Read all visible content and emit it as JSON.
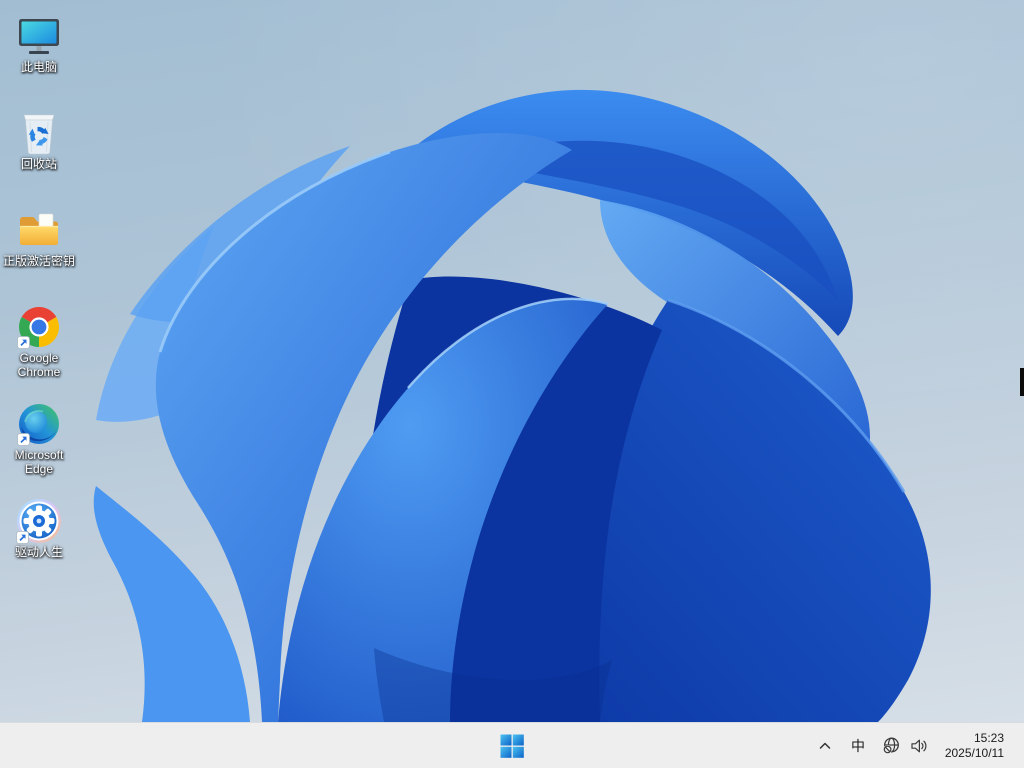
{
  "desktop": {
    "icons": [
      {
        "label": "此电脑",
        "icon": "this-pc-monitor-icon"
      },
      {
        "label": "回收站",
        "icon": "recycle-bin-icon"
      },
      {
        "label": "正版激活密钥",
        "icon": "yellow-folder-icon"
      },
      {
        "label": "Google Chrome",
        "icon": "chrome-logo-icon"
      },
      {
        "label": "Microsoft Edge",
        "icon": "edge-logo-icon"
      },
      {
        "label": "驱动人生",
        "icon": "driver-life-gear-icon"
      }
    ]
  },
  "taskbar": {
    "start_icon": "windows-logo-icon",
    "tray": {
      "overflow_icon": "chevron-up-icon",
      "ime_indicator": "中",
      "network_icon": "globe-no-internet-icon",
      "volume_icon": "speaker-icon",
      "time": "15:23",
      "date": "2025/10/11"
    }
  },
  "colors": {
    "taskbar_bg": "#eeeeee",
    "taskbar_text": "#1b1b1b",
    "wallpaper_sky_top": "#a2bdd2",
    "wallpaper_sky_bottom": "#d6dfe7",
    "bloom_bright_blue": "#3b8af0",
    "bloom_mid_blue": "#1f5ed2",
    "bloom_deep_blue": "#0c34a0",
    "start_logo_blue": "#0d65cc",
    "icon_label_text": "#ffffff"
  }
}
